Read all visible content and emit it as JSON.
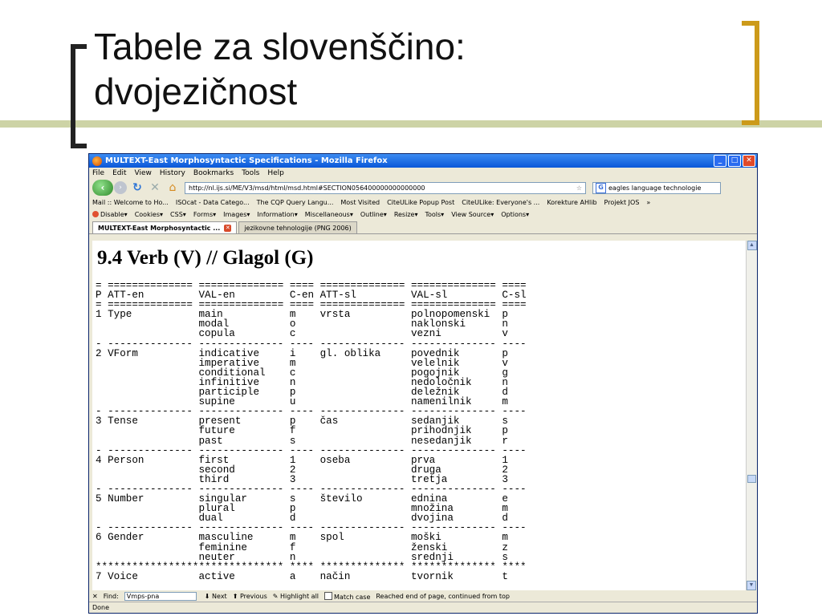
{
  "slide": {
    "title_line1": "Tabele za slovenščino:",
    "title_line2": "dvojezičnost"
  },
  "browser": {
    "window_title": "MULTEXT-East Morphosyntactic Specifications - Mozilla Firefox",
    "menu": [
      "File",
      "Edit",
      "View",
      "History",
      "Bookmarks",
      "Tools",
      "Help"
    ],
    "url": "http://nl.ijs.si/ME/V3/msd/html/msd.html#SECTION056400000000000000",
    "search_value": "eagles language technologie",
    "bookmarks": [
      "Mail :: Welcome to Ho...",
      "ISOcat - Data Catego...",
      "The CQP Query Langu...",
      "Most Visited",
      "CiteULike Popup Post",
      "CiteULike: Everyone's ...",
      "Korekture AHlib",
      "Projekt JOS",
      "»"
    ],
    "toolbar2": [
      "Disable▾",
      "Cookies▾",
      "CSS▾",
      "Forms▾",
      "Images▾",
      "Information▾",
      "Miscellaneous▾",
      "Outline▾",
      "Resize▾",
      "Tools▾",
      "View Source▾",
      "Options▾"
    ],
    "tabs": [
      "MULTEXT-East Morphosyntactic ...",
      "jezikovne tehnologije (PNG 2006)"
    ],
    "find": {
      "label": "Find:",
      "value": "Vmps-pna",
      "next": "Next",
      "previous": "Previous",
      "highlight": "Highlight all",
      "matchcase": "Match case",
      "message": "Reached end of page, continued from top"
    },
    "status": "Done"
  },
  "page": {
    "heading": "9.4 Verb (V) // Glagol (G)",
    "table_header": {
      "p": "P",
      "att_en": "ATT-en",
      "val_en": "VAL-en",
      "c_en": "C-en",
      "att_sl": "ATT-sl",
      "val_sl": "VAL-sl",
      "c_sl": "C-sl"
    },
    "groups": [
      {
        "p": "1",
        "att_en": "Type",
        "att_sl": "vrsta",
        "rows": [
          [
            "main",
            "m",
            "polnopomenski",
            "p"
          ],
          [
            "modal",
            "o",
            "naklonski",
            "n"
          ],
          [
            "copula",
            "c",
            "vezni",
            "v"
          ]
        ]
      },
      {
        "p": "2",
        "att_en": "VForm",
        "att_sl": "gl. oblika",
        "rows": [
          [
            "indicative",
            "i",
            "povednik",
            "p"
          ],
          [
            "imperative",
            "m",
            "velelnik",
            "v"
          ],
          [
            "conditional",
            "c",
            "pogojnik",
            "g"
          ],
          [
            "infinitive",
            "n",
            "nedoločnik",
            "n"
          ],
          [
            "participle",
            "p",
            "deležnik",
            "d"
          ],
          [
            "supine",
            "u",
            "namenilnik",
            "m"
          ]
        ]
      },
      {
        "p": "3",
        "att_en": "Tense",
        "att_sl": "čas",
        "rows": [
          [
            "present",
            "p",
            "sedanjik",
            "s"
          ],
          [
            "future",
            "f",
            "prihodnjik",
            "p"
          ],
          [
            "past",
            "s",
            "nesedanjik",
            "r"
          ]
        ]
      },
      {
        "p": "4",
        "att_en": "Person",
        "att_sl": "oseba",
        "rows": [
          [
            "first",
            "1",
            "prva",
            "1"
          ],
          [
            "second",
            "2",
            "druga",
            "2"
          ],
          [
            "third",
            "3",
            "tretja",
            "3"
          ]
        ]
      },
      {
        "p": "5",
        "att_en": "Number",
        "att_sl": "število",
        "rows": [
          [
            "singular",
            "s",
            "ednina",
            "e"
          ],
          [
            "plural",
            "p",
            "množina",
            "m"
          ],
          [
            "dual",
            "d",
            "dvojina",
            "d"
          ]
        ]
      },
      {
        "p": "6",
        "att_en": "Gender",
        "att_sl": "spol",
        "rows": [
          [
            "masculine",
            "m",
            "moški",
            "m"
          ],
          [
            "feminine",
            "f",
            "ženski",
            "z"
          ],
          [
            "neuter",
            "n",
            "srednji",
            "s"
          ]
        ]
      },
      {
        "p": "7",
        "att_en": "Voice",
        "att_sl": "način",
        "rows": [
          [
            "active",
            "a",
            "tvornik",
            "t"
          ]
        ]
      }
    ]
  }
}
